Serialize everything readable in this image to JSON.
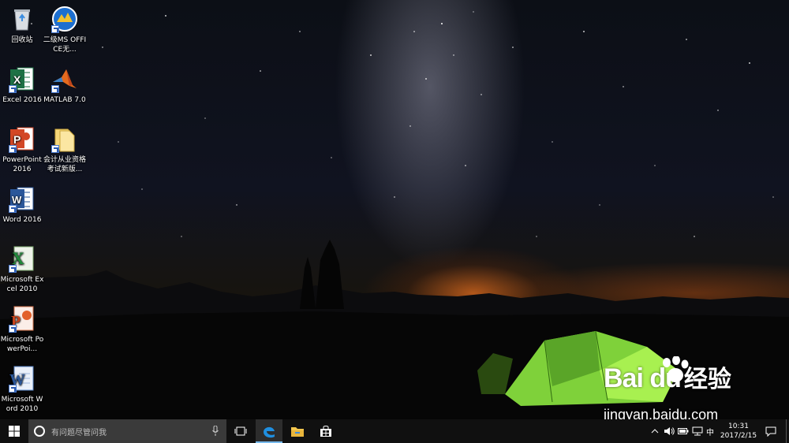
{
  "desktop": {
    "icons": [
      {
        "label": "回收站",
        "icon": "recycle-bin-icon"
      },
      {
        "label": "二级MS OFFICE无...",
        "icon": "ms-office-exam-icon"
      },
      {
        "label": "Excel 2016",
        "icon": "excel-icon"
      },
      {
        "label": "MATLAB 7.0",
        "icon": "matlab-icon"
      },
      {
        "label": "PowerPoint 2016",
        "icon": "powerpoint-icon"
      },
      {
        "label": "会计从业资格考试新版...",
        "icon": "folder-file-icon"
      },
      {
        "label": "Word 2016",
        "icon": "word-icon"
      },
      {
        "label": "Microsoft Excel 2010",
        "icon": "excel-2010-icon"
      },
      {
        "label": "Microsoft PowerPoi...",
        "icon": "powerpoint-2010-icon"
      },
      {
        "label": "Microsoft Word 2010",
        "icon": "word-2010-icon"
      }
    ]
  },
  "watermark": {
    "logo": "Bai du",
    "cn": "经验",
    "url": "jingyan.baidu.com"
  },
  "taskbar": {
    "search_placeholder": "有问题尽管问我",
    "ime": "中",
    "time": "10:31",
    "date": "2017/2/15",
    "pinned": [
      "edge-icon",
      "file-explorer-icon",
      "store-icon"
    ],
    "colors": {
      "bg": "#101010",
      "search_bg": "#3a3a3a",
      "active_accent": "#76b9ed"
    }
  }
}
